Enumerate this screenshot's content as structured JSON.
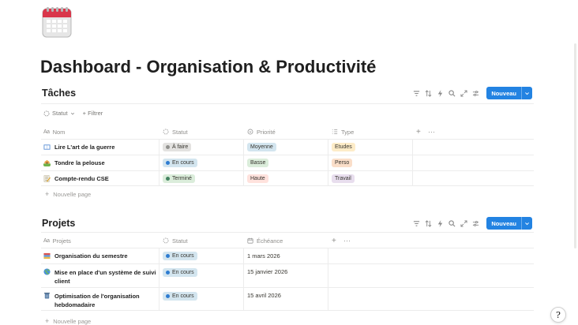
{
  "page": {
    "title": "Dashboard - Organisation & Productivité",
    "icon": "calendar-icon"
  },
  "taches": {
    "title": "Tâches",
    "new_button": "Nouveau",
    "filters": [
      "Statut",
      "+ Filtrer"
    ],
    "columns": [
      "Nom",
      "Statut",
      "Priorité",
      "Type"
    ],
    "rows": [
      {
        "name": "Lire L'art de la guerre",
        "icon": "book-icon",
        "statut": "À faire",
        "priorite": "Moyenne",
        "type": "Etudes"
      },
      {
        "name": "Tondre la pelouse",
        "icon": "house-icon",
        "statut": "En cours",
        "priorite": "Basse",
        "type": "Perso"
      },
      {
        "name": "Compte-rendu CSE",
        "icon": "memo-icon",
        "statut": "Terminé",
        "priorite": "Haute",
        "type": "Travail"
      }
    ],
    "new_page": "Nouvelle page"
  },
  "projets": {
    "title": "Projets",
    "new_button": "Nouveau",
    "columns": [
      "Projets",
      "Statut",
      "Échéance"
    ],
    "rows": [
      {
        "name": "Organisation du semestre",
        "icon": "books-icon",
        "statut": "En cours",
        "echeance": "1 mars 2026"
      },
      {
        "name_line1": "Mise en place d'un système de suivi",
        "name_line2": "client",
        "icon": "globe-icon",
        "statut": "En cours",
        "echeance": "15 janvier 2026"
      },
      {
        "name_line1": "Optimisation de l'organisation",
        "name_line2": "hebdomadaire",
        "icon": "trash-icon",
        "statut": "En cours",
        "echeance": "15 avril 2026"
      }
    ],
    "new_page": "Nouvelle page"
  },
  "colors": {
    "accent": "#2383e2",
    "todo_bg": "#e3e2e0",
    "todo_dot": "#91918e",
    "inprogress_bg": "#d3e5ef",
    "inprogress_dot": "#2e7cd1",
    "done_bg": "#dbeddb",
    "done_dot": "#448361",
    "medium_bg": "#d3e5ef",
    "low_bg": "#dbeddb",
    "high_bg": "#ffe2dd",
    "etudes_bg": "#fdecc8",
    "perso_bg": "#fadec9",
    "travail_bg": "#e8deee"
  },
  "help": {
    "label": "?"
  }
}
